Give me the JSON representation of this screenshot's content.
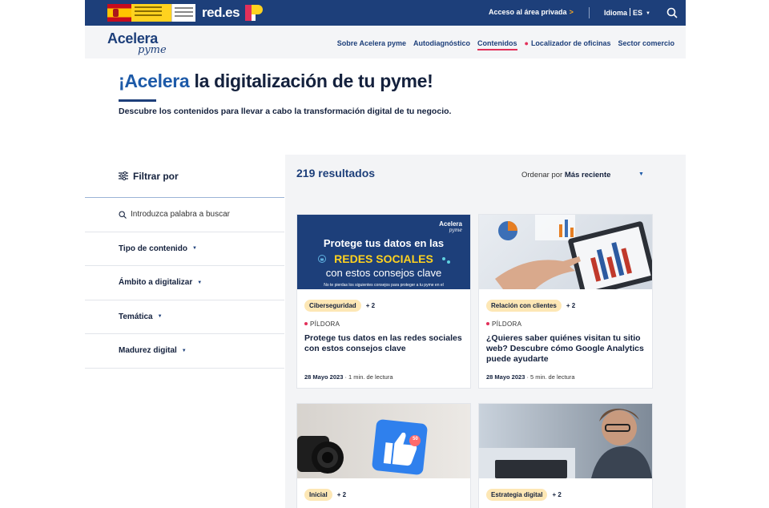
{
  "topbar": {
    "brand_text": "red.es",
    "private_link": "Acceso al área privada",
    "private_arrow": ">",
    "language_label": "Idioma",
    "language_value": "ES"
  },
  "nav": {
    "brand_line1": "Acelera",
    "brand_line2": "pyme",
    "items": [
      {
        "label": "Sobre Acelera pyme"
      },
      {
        "label": "Autodiagnóstico"
      },
      {
        "label": "Contenidos"
      },
      {
        "label": "Localizador de oficinas"
      },
      {
        "label": "Sector comercio"
      }
    ]
  },
  "hero": {
    "title_accent": "¡Acelera",
    "title_rest": " la digitalización de tu pyme!",
    "subtitle": "Descubre los contenidos para llevar a cabo la transformación digital de tu negocio."
  },
  "filters": {
    "heading": "Filtrar por",
    "search_placeholder": "Introduzca palabra a buscar",
    "groups": [
      "Tipo de contenido",
      "Ámbito a digitalizar",
      "Temática",
      "Madurez digital"
    ]
  },
  "results": {
    "count": "219 resultados",
    "sort_label": "Ordenar por",
    "sort_value": "Más reciente"
  },
  "cards": [
    {
      "tag": "Ciberseguridad",
      "more": "+ 2",
      "type": "PÍLDORA",
      "title": "Protege tus datos en las redes sociales con estos consejos clave",
      "date": "28 Mayo 2023",
      "read": "· 1 min. de lectura",
      "thumb_logo1": "Acelera",
      "thumb_logo2": "pyme",
      "thumb_line1": "Protege tus datos en las",
      "thumb_line2": "REDES SOCIALES",
      "thumb_line3": "con estos consejos clave",
      "thumb_line4": "No te pierdas los siguientes consejos para proteger a tu pyme en el"
    },
    {
      "tag": "Relación con clientes",
      "more": "+ 2",
      "type": "PÍLDORA",
      "title": "¿Quieres saber quiénes visitan tu sitio web? Descubre cómo Google Analytics puede ayudarte",
      "date": "28 Mayo 2023",
      "read": "· 5 min. de lectura"
    },
    {
      "tag": "Inicial",
      "more": "+ 2",
      "badge": "50"
    },
    {
      "tag": "Estrategia digital",
      "more": "+ 2"
    }
  ],
  "colors": {
    "primary": "#1d3f7a",
    "accent": "#e2305a",
    "tag_bg": "#fde7b5",
    "highlight": "#ffd21f"
  }
}
